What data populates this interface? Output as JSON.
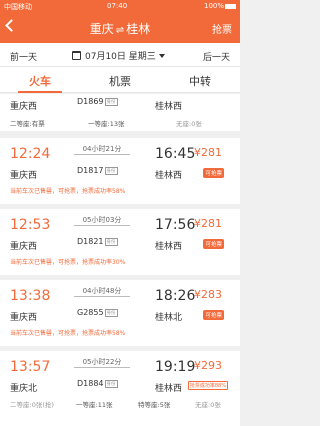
{
  "status_bar": {
    "carrier": "中国移动",
    "time": "07:40",
    "battery": "100%"
  },
  "nav": {
    "from_city": "重庆",
    "swap": "⇌",
    "to_city": "桂林",
    "grab_label": "抢票"
  },
  "date_bar": {
    "prev_label": "前一天",
    "date_label": "07月10日 星期三",
    "next_label": "后一天"
  },
  "tabs": [
    {
      "label": "火车"
    },
    {
      "label": "机票"
    },
    {
      "label": "中转"
    }
  ],
  "top_card": {
    "from": "重庆西",
    "train": "D1869",
    "id_badge": "身份",
    "to": "桂林西",
    "seat1": "二等座:有票",
    "seat2": "一等座:13张",
    "seat3": "无座:0张"
  },
  "trains": [
    {
      "dep": "12:24",
      "arr": "16:45",
      "duration": "04小时21分",
      "train": "D1817",
      "id_badge": "身份",
      "from": "重庆西",
      "to": "桂林西",
      "price": "¥281",
      "note": "当前车次已售罄，可抢票，抢票成功率58%",
      "badge": "可抢票"
    },
    {
      "dep": "12:53",
      "arr": "17:56",
      "duration": "05小时03分",
      "train": "D1821",
      "id_badge": "身份",
      "from": "重庆西",
      "to": "桂林西",
      "price": "¥281",
      "note": "当前车次已售罄，可抢票，抢票成功率30%",
      "badge": "可抢票"
    },
    {
      "dep": "13:38",
      "arr": "18:26",
      "duration": "04小时48分",
      "train": "G2855",
      "id_badge": "身份",
      "from": "重庆西",
      "to": "桂林北",
      "price": "¥283",
      "note": "当前车次已售罄，可抢票，抢票成功率58%",
      "badge": "可抢票"
    },
    {
      "dep": "13:57",
      "arr": "19:19",
      "duration": "05小时22分",
      "train": "D1884",
      "id_badge": "身份",
      "from": "重庆北",
      "to": "桂林西",
      "price": "¥293",
      "badge": "抢票成功率88%"
    }
  ],
  "bottom_seats": {
    "seat1": "二等座:0张(抢)",
    "seat2": "一等座:11张",
    "seat3": "特等座:5张",
    "seat4": "无座:0张"
  }
}
